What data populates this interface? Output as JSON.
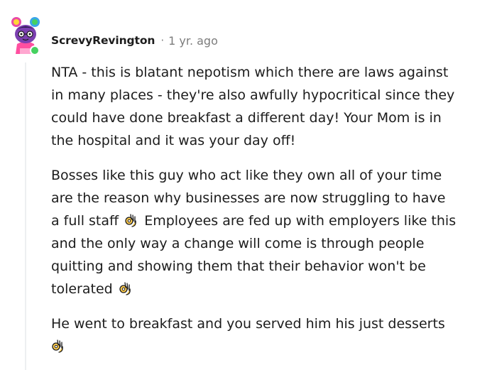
{
  "comment": {
    "username": "ScrevyRevington",
    "separator": "·",
    "timestamp": "1 yr. ago",
    "avatar_icon": "snoo-avatar-icon",
    "online_color": "#46d160",
    "paragraphs": [
      {
        "lines": [
          "NTA - this is blatant nepotism which there are laws against",
          "in many places - they're also awfully hypocritical since they",
          "could have done breakfast a different day! Your Mom is in",
          "the hospital and it was your day off!"
        ]
      },
      {
        "lines": [
          "Bosses like this guy who act like they own all of your time",
          "are the reason why businesses are now struggling to have"
        ],
        "line3_before": "a full staff",
        "line3_after": "Employees are fed up with employers like this",
        "lines_after": [
          "and the only way a change will come is through people",
          "quitting and showing them that their behavior won't be"
        ],
        "last_line": "tolerated"
      },
      {
        "lines": [
          "He went to breakfast and you served him his just desserts"
        ]
      }
    ],
    "emoji_icon": "ok-hand-icon"
  }
}
